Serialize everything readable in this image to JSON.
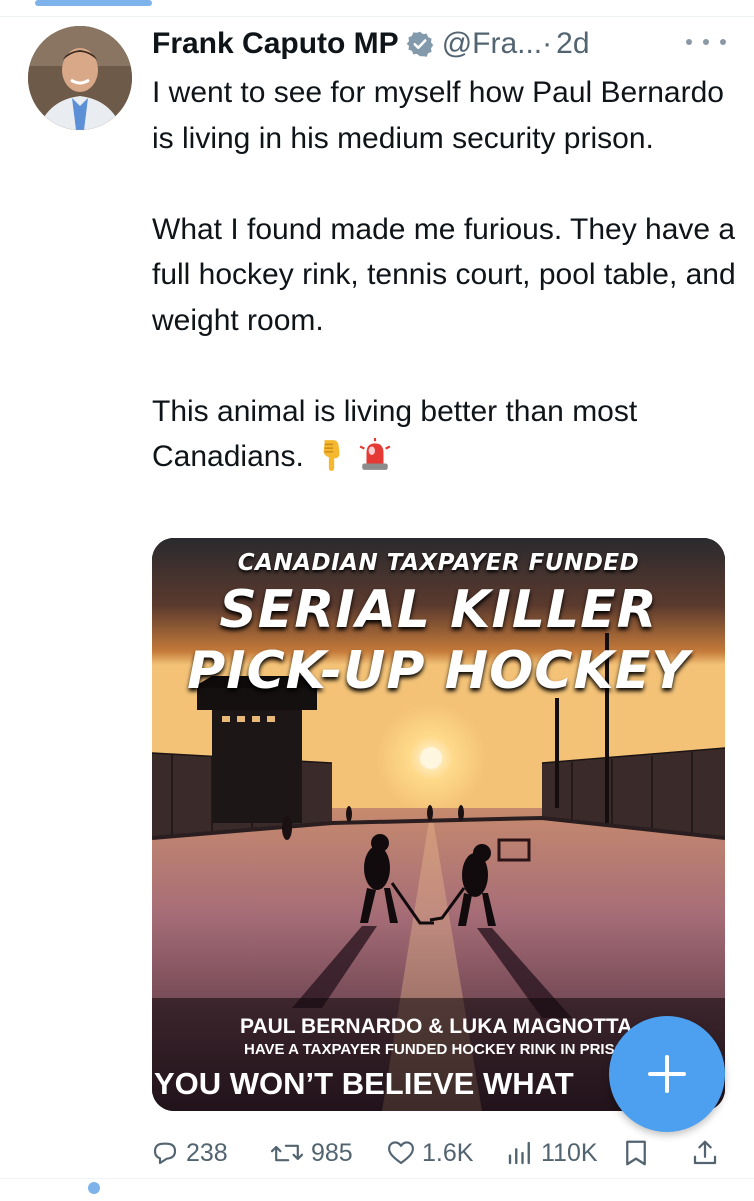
{
  "tweet": {
    "author_name": "Frank Caputo MP",
    "handle": "@Fra...",
    "separator": "·",
    "time": "2d",
    "paragraphs": [
      "I went to see for myself how Paul Bernardo is living in his medium security prison.",
      "What I found made me furious. They have a full hockey rink, tennis court, pool table, and weight room.",
      "This animal is living better than most Canadians."
    ],
    "emojis": [
      "backhand-index-pointing-down",
      "police-car-light"
    ]
  },
  "media": {
    "line1": "CANADIAN TAXPAYER FUNDED",
    "line2": "SERIAL KILLER",
    "line3": "PICK-UP HOCKEY",
    "caption1": "PAUL BERNARDO & LUKA MAGNOTTA",
    "caption2": "HAVE A TAXPAYER FUNDED HOCKEY RINK IN PRISO",
    "caption3": "YOU WON’T BELIEVE WHAT"
  },
  "actions": {
    "replies": "238",
    "reposts": "985",
    "likes": "1.6K",
    "views": "110K"
  },
  "colors": {
    "accent": "#1d9bf0",
    "fab": "#4d9ff0",
    "muted": "#536471",
    "text": "#0f1419"
  },
  "icons": [
    "verified-badge-icon",
    "more-icon",
    "reply-icon",
    "repost-icon",
    "like-icon",
    "views-icon",
    "bookmark-icon",
    "share-icon",
    "compose-icon"
  ]
}
